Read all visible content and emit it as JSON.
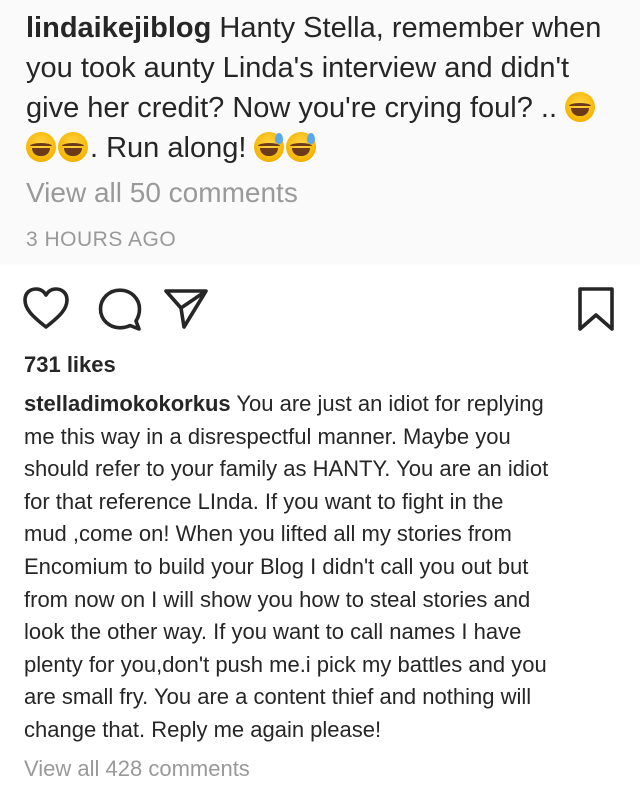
{
  "top_comment": {
    "username": "lindaikejiblog",
    "line1_text": " Hanty Stella, remember when",
    "line2_text": "you took aunty Linda's interview and didn't",
    "line3_text": "give her credit? Now you're crying foul? .. ",
    "line4_text": ". Run along! ",
    "emoji_name": "tears-of-joy-emoji",
    "sweat_emoji_name": "grinning-sweat-emoji"
  },
  "view_all_top": "View all 50 comments",
  "time_ago": "3 HOURS AGO",
  "actions": {
    "like_icon": "heart-icon",
    "comment_icon": "comment-bubble-icon",
    "share_icon": "paper-plane-icon",
    "save_icon": "bookmark-icon"
  },
  "likes": "731 likes",
  "caption": {
    "username": "stelladimokokorkus",
    "lines": [
      " You are just an idiot for replying",
      "me this way in a disrespectful manner. Maybe you",
      "should refer to your family as HANTY. You are an idiot",
      "for that reference LInda. If you want to fight in the",
      "mud ,come on! When you lifted all my stories from",
      "Encomium to build your Blog I didn't call you out but",
      "from now on I will show you how to steal stories and",
      "look the other way. If you want to call names I have",
      "plenty for you,don't push me.i pick my battles and you",
      "are small fry. You are a content thief and nothing will",
      "change that. Reply me again please!"
    ]
  },
  "view_all_bottom": "View all 428 comments",
  "colors": {
    "text": "#262626",
    "muted": "#999999",
    "top_background": "#fafafa"
  }
}
